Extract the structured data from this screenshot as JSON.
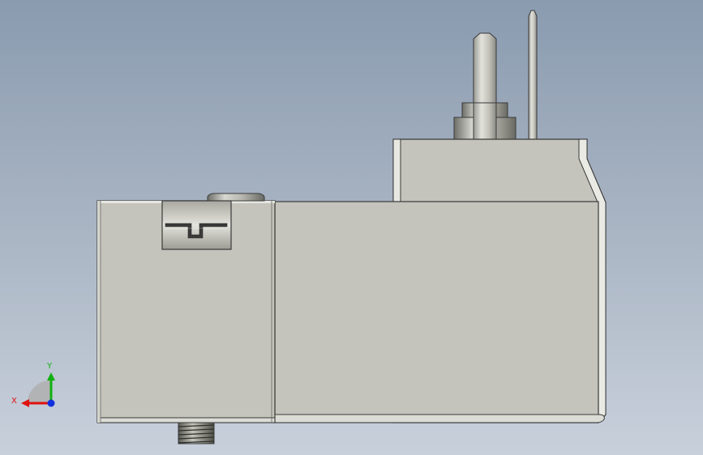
{
  "viewport": {
    "background_top": "#8a9bb0",
    "background_bottom": "#c8d0db",
    "part_fill": "#c4c4bc",
    "part_edge": "#3a3a3a"
  },
  "triad": {
    "x_label": "X",
    "y_label": "Y",
    "x_color": "#e01010",
    "y_color": "#10b010",
    "z_color": "#1030e0"
  }
}
